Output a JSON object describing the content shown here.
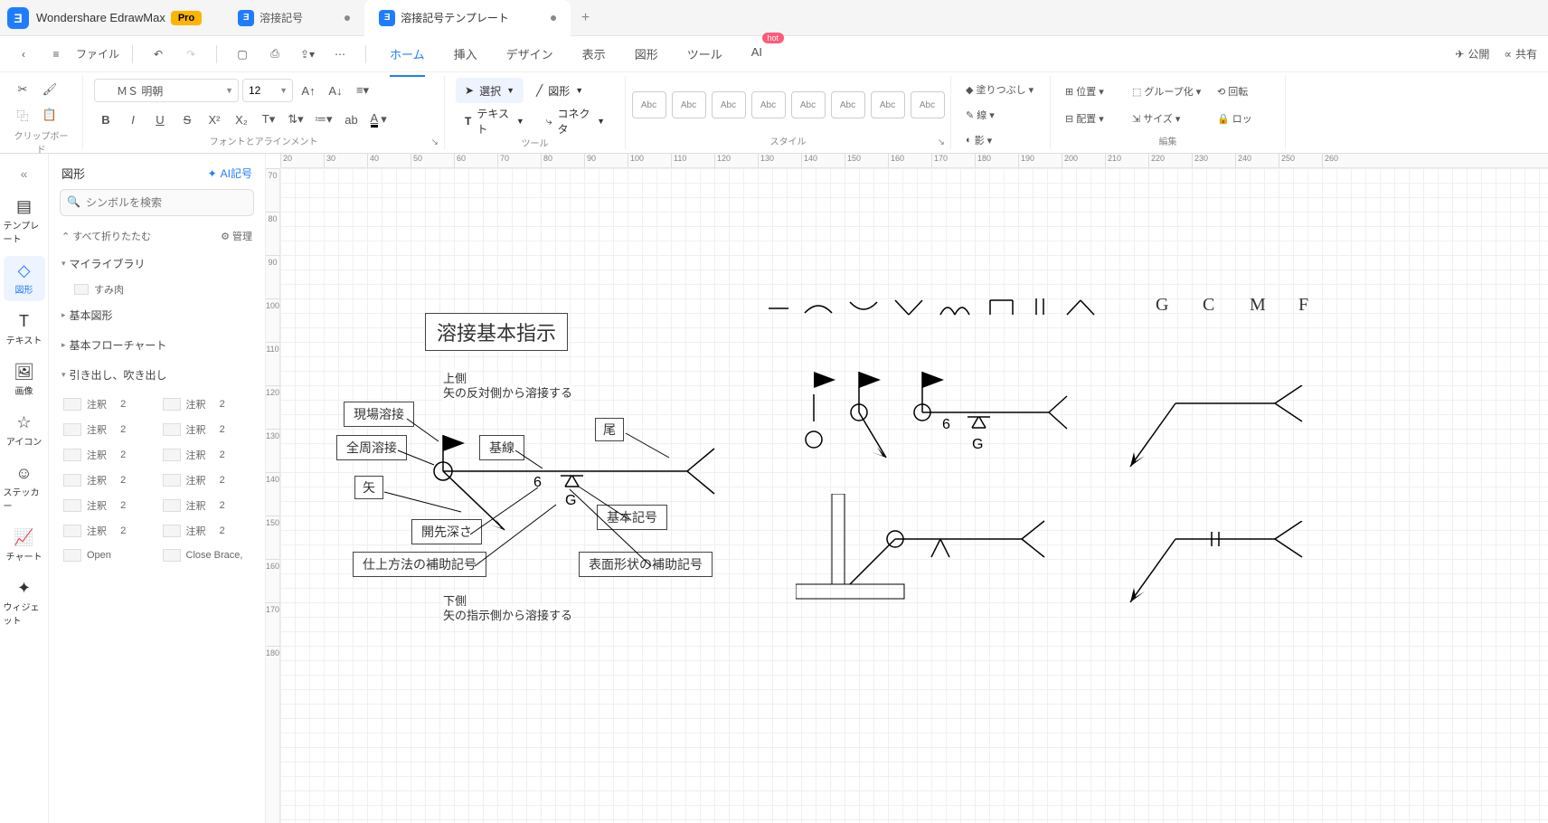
{
  "app": {
    "title": "Wondershare EdrawMax",
    "pro": "Pro"
  },
  "tabs": [
    {
      "label": "溶接記号",
      "dirty": true
    },
    {
      "label": "溶接記号テンプレート",
      "dirty": true
    }
  ],
  "file_menu": "ファイル",
  "menu": {
    "home": "ホーム",
    "insert": "挿入",
    "design": "デザイン",
    "view": "表示",
    "shape": "図形",
    "tool": "ツール",
    "ai": "AI",
    "hot": "hot"
  },
  "topright": {
    "publish": "公開",
    "share": "共有"
  },
  "ribbon": {
    "clipboard": "クリップボード",
    "font_align": "フォントとアラインメント",
    "tools": "ツール",
    "style": "スタイル",
    "edit": "編集",
    "font_name": "ＭＳ 明朝",
    "font_size": "12",
    "select": "選択",
    "shape_btn": "図形",
    "text_btn": "テキスト",
    "connector_btn": "コネクタ",
    "style_label": "Abc",
    "fill": "塗りつぶし",
    "line": "線",
    "shadow": "影",
    "position": "位置",
    "align": "配置",
    "group": "グループ化",
    "size": "サイズ",
    "rotate": "回転",
    "lock": "ロッ"
  },
  "rail": {
    "template": "テンプレート",
    "shape": "図形",
    "text": "テキスト",
    "image": "画像",
    "icon": "アイコン",
    "sticker": "ステッカー",
    "chart": "チャート",
    "widget": "ウィジェット"
  },
  "shapes_panel": {
    "title": "図形",
    "ai_symbol": "AI記号",
    "search_placeholder": "シンボルを検索",
    "collapse_all": "すべて折りたたむ",
    "manage": "管理",
    "categories": {
      "my_library": "マイライブラリ",
      "sumi": "すみ肉",
      "basic_shapes": "基本図形",
      "basic_flowchart": "基本フローチャート",
      "callouts": "引き出し、吹き出し"
    },
    "annotation_label": "注釈",
    "annotation_num": "2",
    "open": "Open",
    "close_brace": "Close Brace,"
  },
  "ruler_h": [
    "20",
    "30",
    "40",
    "50",
    "60",
    "70",
    "80",
    "90",
    "100",
    "110",
    "120",
    "130",
    "140",
    "150",
    "160",
    "170",
    "180",
    "190",
    "200",
    "210",
    "220",
    "230",
    "240",
    "250",
    "260"
  ],
  "ruler_v": [
    "70",
    "80",
    "90",
    "100",
    "110",
    "120",
    "130",
    "140",
    "150",
    "160",
    "170",
    "180"
  ],
  "canvas": {
    "title_box": "溶接基本指示",
    "labels": {
      "field_weld": "現場溶接",
      "all_around": "全周溶接",
      "arrow": "矢",
      "reference_line": "基線",
      "tail": "尾",
      "basic_symbol": "基本記号",
      "groove_depth": "開先深さ",
      "finish_aux": "仕上方法の補助記号",
      "surface_aux": "表面形状の補助記号",
      "upper1": "上側",
      "upper2": "矢の反対側から溶接する",
      "lower1": "下側",
      "lower2": "矢の指示側から溶接する",
      "six": "6",
      "G": "G"
    },
    "letters": [
      "G",
      "C",
      "M",
      "F"
    ],
    "right_six": "6",
    "right_G": "G"
  }
}
